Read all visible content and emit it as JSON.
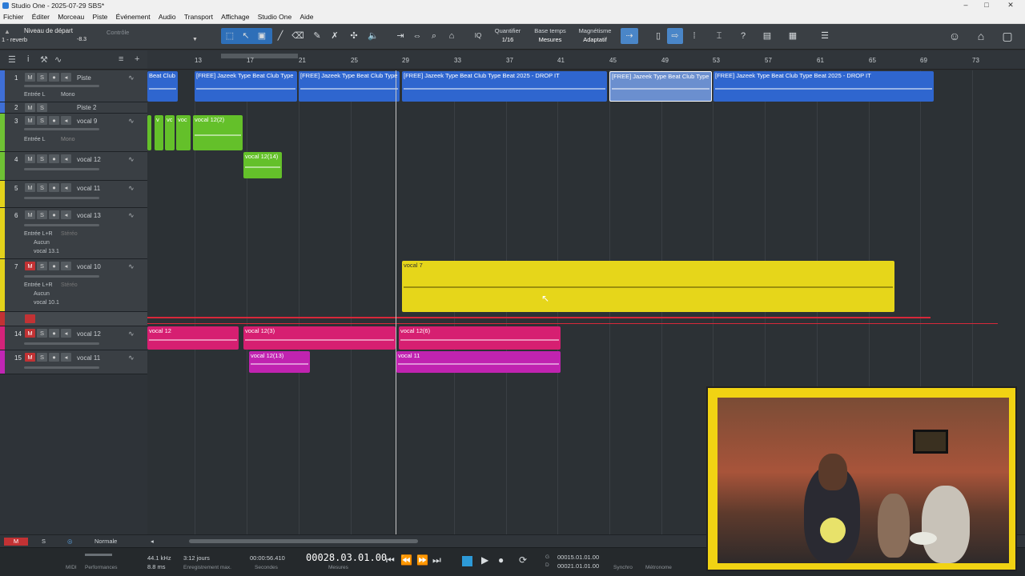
{
  "window": {
    "title": "Studio One - 2025-07-29 SBS*",
    "controls": [
      "–",
      "□",
      "✕"
    ]
  },
  "menu": [
    "Fichier",
    "Éditer",
    "Morceau",
    "Piste",
    "Événement",
    "Audio",
    "Transport",
    "Affichage",
    "Studio One",
    "Aide"
  ],
  "toolbar": {
    "start_level": "Niveau de départ",
    "reverb": "1 - reverb",
    "level_value": "-8.3",
    "controle": "Contrôle",
    "quantize_label": "Quantifier",
    "quantize_value": "1/16",
    "timebase_label": "Base temps",
    "timebase_value": "Mesures",
    "snap_label": "Magnétisme",
    "snap_value": "Adaptatif",
    "iq": "IQ"
  },
  "ruler": {
    "bars": [
      "13",
      "17",
      "21",
      "25",
      "29",
      "33",
      "37",
      "41",
      "45",
      "49",
      "53",
      "57",
      "61",
      "65",
      "69",
      "73"
    ]
  },
  "tracks": [
    {
      "num": "1",
      "name": "Piste",
      "input": "Entrée L",
      "mode": "Mono",
      "color": "#3f6fd6",
      "muted": false
    },
    {
      "num": "2",
      "name": "Piste 2",
      "color": "#3f6fd6",
      "muted": false
    },
    {
      "num": "3",
      "name": "vocal 9",
      "input": "Entrée L",
      "mode": "Mono",
      "color": "#6fc234",
      "muted": false
    },
    {
      "num": "4",
      "name": "vocal 12",
      "color": "#6fc234",
      "muted": false
    },
    {
      "num": "5",
      "name": "vocal 11",
      "color": "#e3d21b",
      "muted": false
    },
    {
      "num": "6",
      "name": "vocal 13",
      "input": "Entrée L+R",
      "mode": "Stéréo",
      "send": "Aucun",
      "route": "vocal 13.1",
      "color": "#e3d21b",
      "muted": false
    },
    {
      "num": "7",
      "name": "vocal 10",
      "input": "Entrée L+R",
      "mode": "Stéréo",
      "send": "Aucun",
      "route": "vocal 10.1",
      "color": "#e3d21b",
      "muted": true
    },
    {
      "num": "14",
      "name": "vocal 12",
      "color": "#d4237a",
      "muted": true
    },
    {
      "num": "15",
      "name": "vocal 11",
      "color": "#c126b4",
      "muted": true
    }
  ],
  "clips": {
    "c1": "Beat  Club",
    "c2": "[FREE] Jazeek Type Beat  Club Type",
    "c3": "[FREE] Jazeek Type Beat  Club Type",
    "c4": "[FREE] Jazeek Type Beat  Club Type Beat 2025 - DROP IT",
    "c5": "[FREE] Jazeek Type Beat  Club Type",
    "c6": "[FREE] Jazeek Type Beat  Club Type Beat 2025 - DROP IT",
    "g1": "v",
    "g2": "vc",
    "g3": "voc",
    "g4": "vocal 12(2)",
    "g5": "vocal 12(14)",
    "y1": "vocal 7",
    "p1": "vocal 12",
    "p2": "vocal 12(3)",
    "p3": "vocal 12(6)",
    "p4": "vocal 12(13)",
    "p5": "vocal 11"
  },
  "bottom": {
    "m": "M",
    "s": "S",
    "mode": "Normale"
  },
  "transport": {
    "midi": "MIDI",
    "perf": "Performances",
    "rate": "44.1 kHz",
    "latency": "8.8 ms",
    "days": "3:12 jours",
    "rec_max": "Enregistrement max.",
    "seconds_val": "00:00:56.410",
    "seconds_lbl": "Secondes",
    "bars_val": "00028.03.01.00",
    "bars_lbl": "Mesures",
    "loop_g": "00015.01.01.00",
    "loop_d": "00021.01.01.00",
    "g": "G",
    "d": "D",
    "sync": "Synchro",
    "metro": "Métronome"
  },
  "colors": {
    "blue": "#2f66cf",
    "green": "#64c02a",
    "yellow": "#e6d61a",
    "pink": "#d61f71",
    "magenta": "#c023b0"
  }
}
